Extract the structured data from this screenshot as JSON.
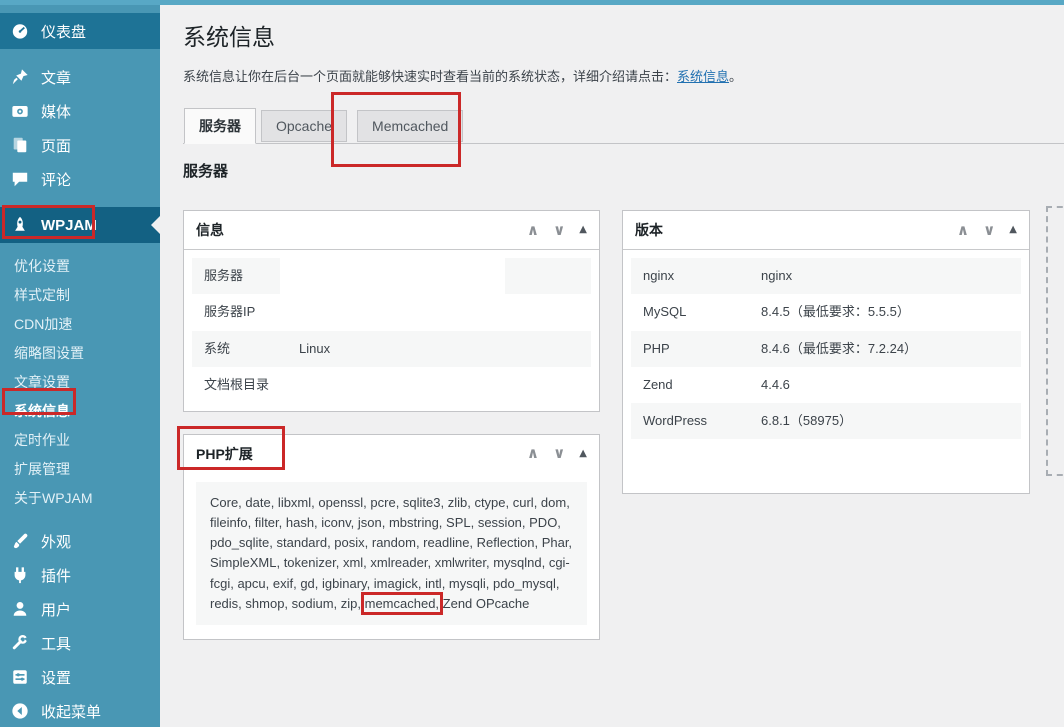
{
  "annotation_color": "#cb2828",
  "sidebar_color": "#4997b4",
  "sidebar": {
    "top_items": [
      {
        "label": "仪表盘",
        "icon": "dashboard-icon"
      },
      {
        "label": "文章",
        "icon": "pin-icon"
      },
      {
        "label": "媒体",
        "icon": "media-icon"
      },
      {
        "label": "页面",
        "icon": "pages-icon"
      },
      {
        "label": "评论",
        "icon": "comments-icon"
      }
    ],
    "wpjam": {
      "label": "WPJAM",
      "icon": "wpjam-icon"
    },
    "submenu": {
      "items": [
        {
          "label": "优化设置"
        },
        {
          "label": "样式定制"
        },
        {
          "label": "CDN加速"
        },
        {
          "label": "缩略图设置"
        },
        {
          "label": "文章设置"
        },
        {
          "label": "系统信息",
          "active": true
        },
        {
          "label": "定时作业"
        },
        {
          "label": "扩展管理"
        },
        {
          "label": "关于WPJAM"
        }
      ]
    },
    "bottom_items": [
      {
        "label": "外观",
        "icon": "appearance-icon"
      },
      {
        "label": "插件",
        "icon": "plugins-icon"
      },
      {
        "label": "用户",
        "icon": "users-icon"
      },
      {
        "label": "工具",
        "icon": "tools-icon"
      },
      {
        "label": "设置",
        "icon": "settings-icon"
      },
      {
        "label": "收起菜单",
        "icon": "collapse-menu-icon"
      }
    ]
  },
  "page": {
    "title": "系统信息",
    "description_before": "系统信息让你在后台一个页面就能够快速实时查看当前的系统状态，详细介绍请点击：",
    "description_link": "系统信息",
    "description_after": "。",
    "tabs": [
      {
        "label": "服务器",
        "active": true
      },
      {
        "label": "Opcache",
        "active": false
      },
      {
        "label": "Memcached",
        "active": false
      }
    ],
    "section_heading": "服务器"
  },
  "panel_controls": {
    "move_up_glyph": "∧",
    "move_down_glyph": "∨",
    "collapse_glyph": "▲"
  },
  "panels": {
    "info": {
      "title": "信息",
      "rows": [
        {
          "label": "服务器",
          "value": ""
        },
        {
          "label": "服务器IP",
          "value": ""
        },
        {
          "label": "系统",
          "value": "Linux"
        },
        {
          "label": "文档根目录",
          "value": ""
        }
      ]
    },
    "php_ext": {
      "title": "PHP扩展",
      "extensions_before": "Core, date, libxml, openssl, pcre, sqlite3, zlib, ctype, curl, dom, fileinfo, filter, hash, iconv, json, mbstring, SPL, session, PDO, pdo_sqlite, standard, posix, random, readline, Reflection, Phar, SimpleXML, tokenizer, xml, xmlreader, xmlwriter, mysqlnd, cgi-fcgi, apcu, exif, gd, igbinary, imagick, intl, mysqli, pdo_mysql, redis, shmop, sodium, zip, ",
      "extensions_highlight": "memcached,",
      "extensions_after": " Zend OPcache"
    },
    "version": {
      "title": "版本",
      "rows": [
        {
          "label": "nginx",
          "value": "nginx"
        },
        {
          "label": "MySQL",
          "value": "8.4.5（最低要求：5.5.5）"
        },
        {
          "label": "PHP",
          "value": "8.4.6（最低要求：7.2.24）"
        },
        {
          "label": "Zend",
          "value": "4.4.6"
        },
        {
          "label": "WordPress",
          "value": "6.8.1（58975）"
        }
      ]
    }
  }
}
